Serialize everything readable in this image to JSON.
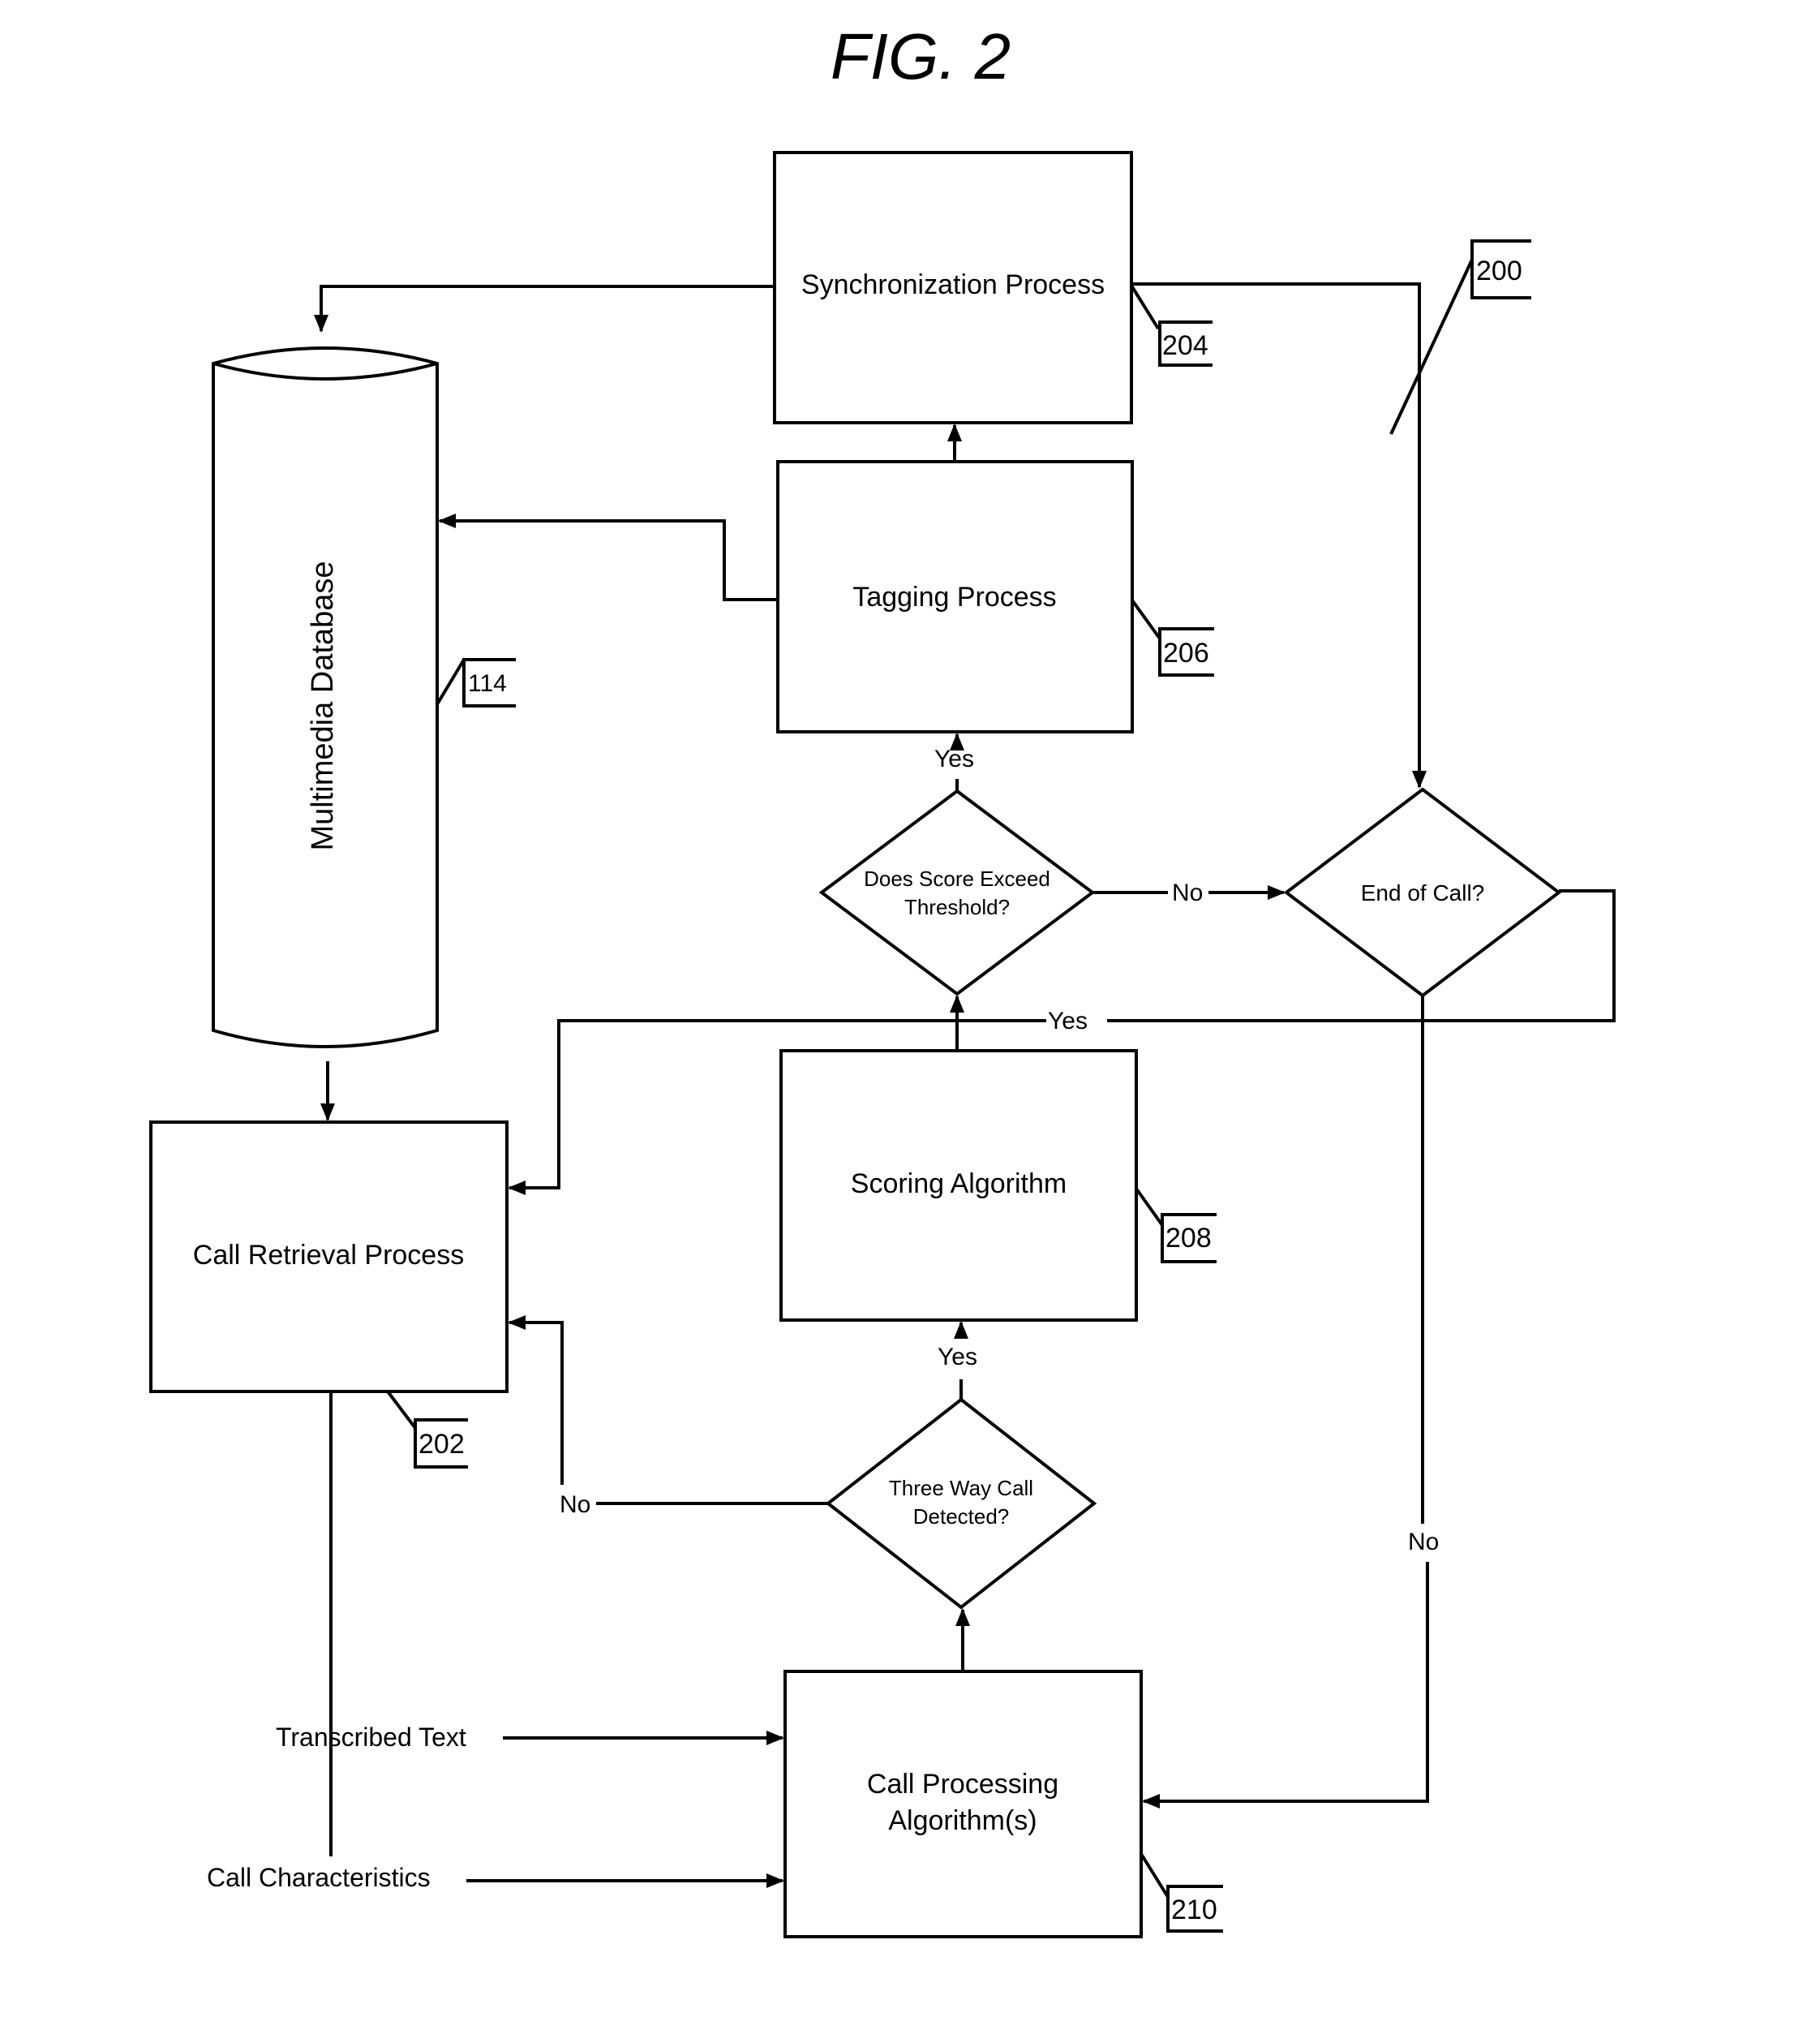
{
  "figure": {
    "title": "FIG. 2",
    "reference": "200"
  },
  "nodes": {
    "sync": {
      "label": "Synchronization Process",
      "ref": "204"
    },
    "tagging": {
      "label": "Tagging Process",
      "ref": "206"
    },
    "scoring": {
      "label": "Scoring Algorithm",
      "ref": "208"
    },
    "call_processing": {
      "line1": "Call Processing",
      "line2": "Algorithm(s)",
      "ref": "210"
    },
    "call_retrieval": {
      "label": "Call Retrieval Process",
      "ref": "202"
    },
    "database": {
      "label": "Multimedia Database",
      "ref": "114"
    },
    "score_decision": {
      "line1": "Does Score Exceed",
      "line2": "Threshold?"
    },
    "end_decision": {
      "label": "End of Call?"
    },
    "three_way_decision": {
      "line1": "Three Way Call",
      "line2": "Detected?"
    }
  },
  "edge_labels": {
    "score_yes": "Yes",
    "score_no": "No",
    "end_yes": "Yes",
    "end_no": "No",
    "three_way_yes": "Yes",
    "three_way_no": "No"
  },
  "inputs": {
    "transcribed_text": "Transcribed Text",
    "call_characteristics": "Call Characteristics"
  }
}
